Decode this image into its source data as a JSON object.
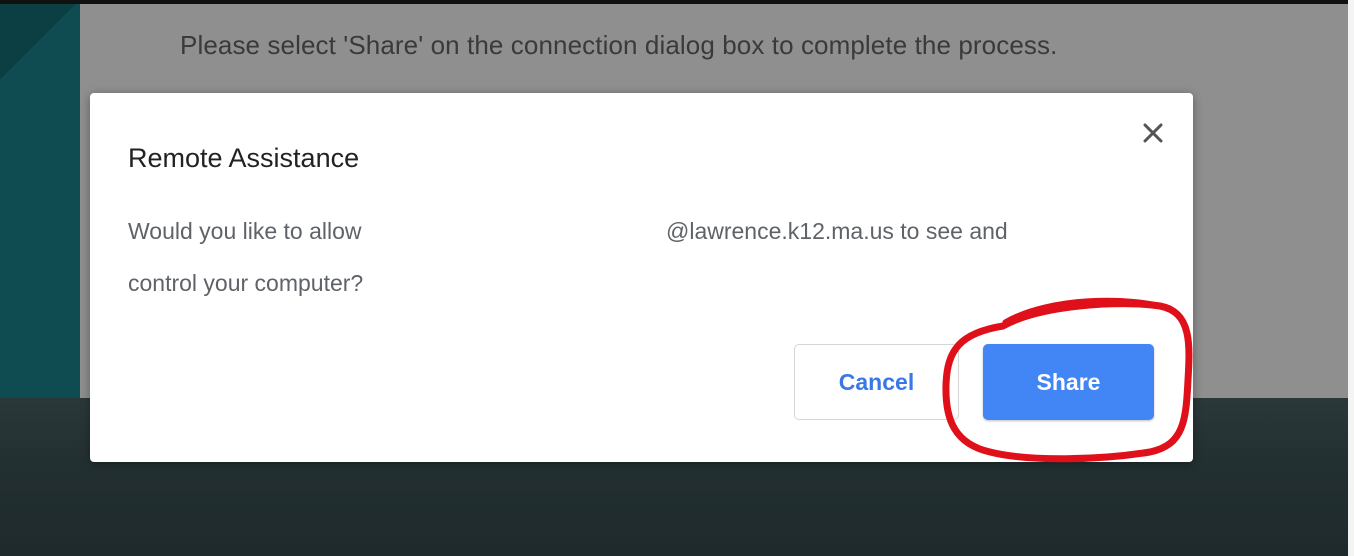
{
  "background": {
    "instruction_text": "Please select 'Share' on the connection dialog box to complete the process."
  },
  "dialog": {
    "title": "Remote Assistance",
    "message_line1_start": "Would you like to allow",
    "message_line1_end": "@lawrence.k12.ma.us to see and",
    "message_line2": "control your computer?",
    "close_icon": "close-icon",
    "cancel_label": "Cancel",
    "share_label": "Share"
  },
  "colors": {
    "primary_button": "#4285f4",
    "cancel_text": "#3b78e7",
    "annotation_circle": "#e0101a"
  }
}
